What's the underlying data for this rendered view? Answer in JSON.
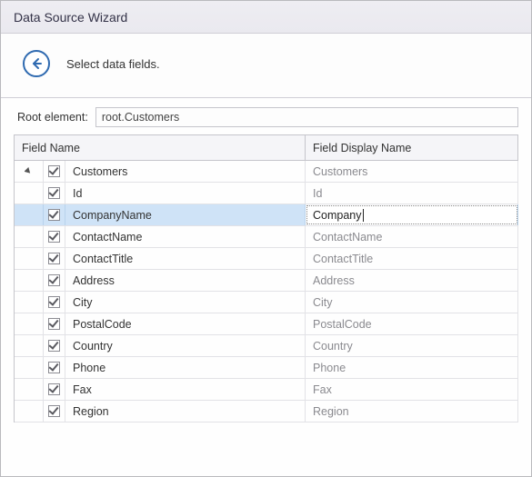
{
  "title": "Data Source Wizard",
  "header": {
    "instruction": "Select data fields."
  },
  "root": {
    "label": "Root element:",
    "value": "root.Customers"
  },
  "columns": {
    "field_name": "Field Name",
    "display_name": "Field Display Name"
  },
  "tree": {
    "parent": {
      "name": "Customers",
      "display": "Customers",
      "checked": true,
      "expanded": true
    },
    "children": [
      {
        "name": "Id",
        "display": "Id",
        "checked": true,
        "selected": false,
        "editing": false
      },
      {
        "name": "CompanyName",
        "display": "Company",
        "checked": true,
        "selected": true,
        "editing": true
      },
      {
        "name": "ContactName",
        "display": "ContactName",
        "checked": true,
        "selected": false,
        "editing": false
      },
      {
        "name": "ContactTitle",
        "display": "ContactTitle",
        "checked": true,
        "selected": false,
        "editing": false
      },
      {
        "name": "Address",
        "display": "Address",
        "checked": true,
        "selected": false,
        "editing": false
      },
      {
        "name": "City",
        "display": "City",
        "checked": true,
        "selected": false,
        "editing": false
      },
      {
        "name": "PostalCode",
        "display": "PostalCode",
        "checked": true,
        "selected": false,
        "editing": false
      },
      {
        "name": "Country",
        "display": "Country",
        "checked": true,
        "selected": false,
        "editing": false
      },
      {
        "name": "Phone",
        "display": "Phone",
        "checked": true,
        "selected": false,
        "editing": false
      },
      {
        "name": "Fax",
        "display": "Fax",
        "checked": true,
        "selected": false,
        "editing": false
      },
      {
        "name": "Region",
        "display": "Region",
        "checked": true,
        "selected": false,
        "editing": false
      }
    ]
  }
}
